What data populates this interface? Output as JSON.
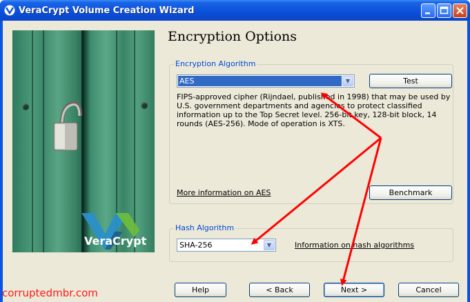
{
  "window": {
    "title": "VeraCrypt Volume Creation Wizard",
    "icon": "veracrypt-logo-icon"
  },
  "page": {
    "title": "Encryption Options"
  },
  "branding": {
    "logo_text": "VeraCrypt",
    "logo_colors": [
      "#2b8fc9",
      "#1d5f8f",
      "#6fbf3a"
    ]
  },
  "encryption": {
    "group_label": "Encryption Algorithm",
    "selected": "AES",
    "test_label": "Test",
    "description": "FIPS-approved cipher (Rijndael, published in 1998) that may be used by U.S. government departments and agencies to protect classified information up to the Top Secret level. 256-bit key, 128-bit block, 14 rounds (AES-256). Mode of operation is XTS.",
    "more_info_link": "More information on AES",
    "benchmark_label": "Benchmark"
  },
  "hash": {
    "group_label": "Hash Algorithm",
    "selected": "SHA-256",
    "info_link": "Information on hash algorithms"
  },
  "buttons": {
    "help": "Help",
    "back": "< Back",
    "next": "Next >",
    "cancel": "Cancel"
  },
  "watermark": "corruptedmbr.com",
  "annotation_color": "#ff0000"
}
